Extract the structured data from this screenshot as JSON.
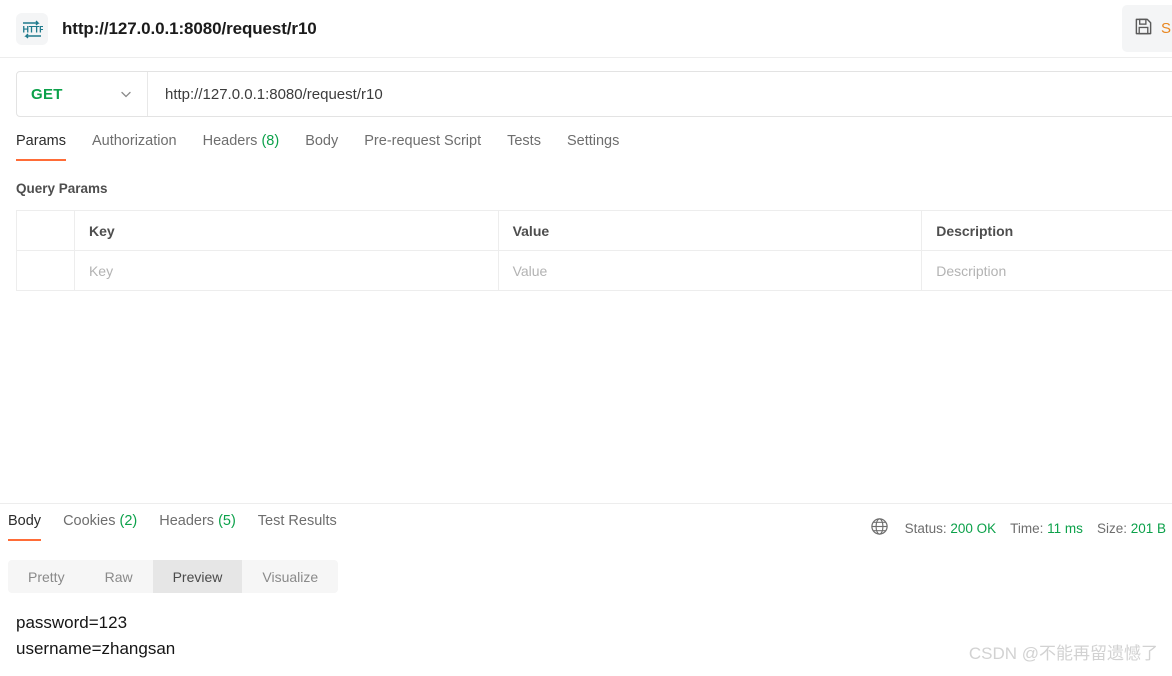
{
  "header": {
    "icon": "http-protocol-icon",
    "request_title": "http://127.0.0.1:8080/request/r10",
    "save_icon": "floppy-disk-save-icon",
    "save_label": "S"
  },
  "url_bar": {
    "method": "GET",
    "method_chevron": "chevron-down-icon",
    "url": "http://127.0.0.1:8080/request/r10"
  },
  "request_tabs": [
    {
      "label": "Params",
      "count": "",
      "active": true
    },
    {
      "label": "Authorization",
      "count": "",
      "active": false
    },
    {
      "label": "Headers",
      "count": "(8)",
      "active": false
    },
    {
      "label": "Body",
      "count": "",
      "active": false
    },
    {
      "label": "Pre-request Script",
      "count": "",
      "active": false
    },
    {
      "label": "Tests",
      "count": "",
      "active": false
    },
    {
      "label": "Settings",
      "count": "",
      "active": false
    }
  ],
  "query_params": {
    "section_label": "Query Params",
    "columns": [
      "",
      "Key",
      "Value",
      "Description"
    ],
    "rows": [
      {
        "check": "",
        "key": "Key",
        "value": "Value",
        "description": "Description"
      }
    ]
  },
  "response": {
    "tabs": [
      {
        "label": "Body",
        "count": "",
        "active": true
      },
      {
        "label": "Cookies",
        "count": "(2)",
        "active": false
      },
      {
        "label": "Headers",
        "count": "(5)",
        "active": false
      },
      {
        "label": "Test Results",
        "count": "",
        "active": false
      }
    ],
    "status_icon": "globe-icon",
    "status": {
      "label": "Status:",
      "value": "200 OK"
    },
    "time": {
      "label": "Time:",
      "value": "11 ms"
    },
    "size": {
      "label": "Size:",
      "value": "201 B"
    },
    "view_modes": [
      {
        "label": "Pretty",
        "active": false
      },
      {
        "label": "Raw",
        "active": false
      },
      {
        "label": "Preview",
        "active": true
      },
      {
        "label": "Visualize",
        "active": false
      }
    ],
    "body_text": "password=123\nusername=zhangsan"
  },
  "watermark": "CSDN @不能再留遗憾了",
  "colors": {
    "accent_orange": "#ff6c37",
    "method_green": "#0ca14a",
    "status_green": "#0ca14a",
    "save_orange": "#e8861f",
    "http_icon_teal": "#1f7a8c"
  }
}
